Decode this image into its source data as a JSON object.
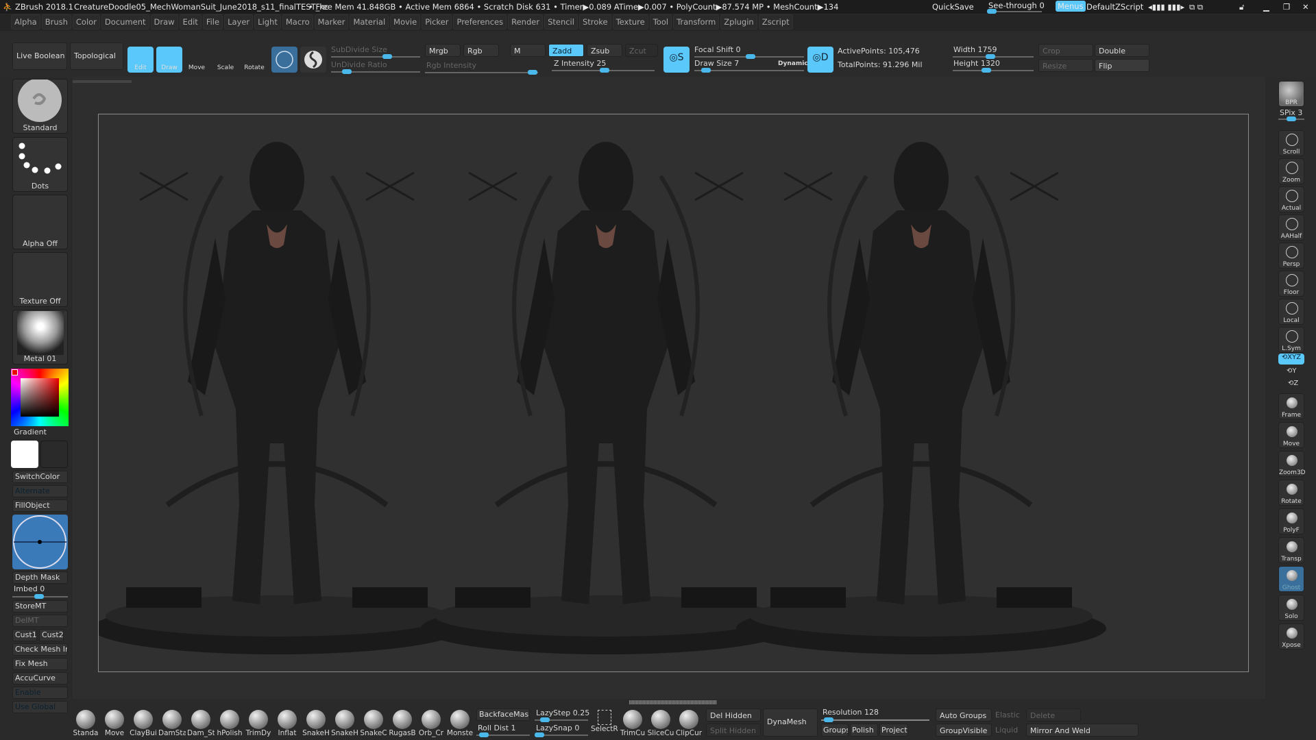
{
  "title": {
    "app": "ZBrush 2018.1",
    "file": "CreatureDoodle05_MechWomanSuit_June2018_s11_finalTEST_kc",
    "stats": "• Free Mem 41.848GB • Active Mem 6864 • Scratch Disk 631 • Timer▶0.089 ATime▶0.007 • PolyCount▶87.574 MP • MeshCount▶134",
    "quicksave": "QuickSave",
    "see_through": "See-through  0",
    "menus": "Menus",
    "script": "DefaultZScript"
  },
  "menus": [
    "Alpha",
    "Brush",
    "Color",
    "Document",
    "Draw",
    "Edit",
    "File",
    "Layer",
    "Light",
    "Macro",
    "Marker",
    "Material",
    "Movie",
    "Picker",
    "Preferences",
    "Render",
    "Stencil",
    "Stroke",
    "Texture",
    "Tool",
    "Transform",
    "Zplugin",
    "Zscript"
  ],
  "toolbar": {
    "live_boolean": "Live Boolean",
    "topological": "Topological",
    "edit": "Edit",
    "draw": "Draw",
    "move": "Move",
    "scale": "Scale",
    "rotate": "Rotate",
    "subdivide_size": "SubDivide Size",
    "undivide_ratio": "UnDivide Ratio",
    "mrgb": "Mrgb",
    "rgb": "Rgb",
    "rgb_intensity": "Rgb Intensity",
    "m": "M",
    "zadd": "Zadd",
    "zsub": "Zsub",
    "zcut": "Zcut",
    "z_intensity": "Z Intensity 25",
    "focal_shift": "Focal Shift 0",
    "draw_size": "Draw Size 7",
    "dynamic": "Dynamic",
    "active_points": "ActivePoints: 105,476",
    "total_points": "TotalPoints: 91.296 Mil",
    "width": "Width 1759",
    "height": "Height 1320",
    "crop": "Crop",
    "resize": "Resize",
    "double": "Double",
    "flip": "Flip",
    "accent": "#5ac8fa"
  },
  "left": {
    "brush": "Standard",
    "stroke": "Dots",
    "alpha": "Alpha Off",
    "texture": "Texture Off",
    "material": "Metal 01",
    "gradient": "Gradient",
    "switch_color": "SwitchColor",
    "alternate": "Alternate",
    "fill_object": "FillObject",
    "depth_mask": "Depth Mask",
    "imbed": "Imbed 0",
    "store_mt": "StoreMT",
    "del_mt": "DelMT",
    "cust1": "Cust1",
    "cust2": "Cust2",
    "check_mesh": "Check Mesh Int",
    "fix_mesh": "Fix Mesh",
    "accucurve": "AccuCurve",
    "enable": "Enable",
    "use_global": "Use Global"
  },
  "right": {
    "bpr": "BPR",
    "spix": "SPix 3",
    "buttons": [
      {
        "label": "Scroll",
        "icon": "hand-icon"
      },
      {
        "label": "Zoom",
        "icon": "magnifier-icon"
      },
      {
        "label": "Actual",
        "icon": "magnifier-icon"
      },
      {
        "label": "AAHalf",
        "icon": "magnifier-icon"
      },
      {
        "label": "Persp",
        "icon": "grid-icon",
        "on": true
      },
      {
        "label": "Floor",
        "icon": "floor-icon"
      },
      {
        "label": "Local",
        "icon": "local-icon",
        "on": true
      },
      {
        "label": "L.Sym",
        "icon": "symmetry-icon"
      }
    ],
    "xyz": "XYZ",
    "y": "Y",
    "z": "Z",
    "buttons2": [
      {
        "label": "Frame",
        "icon": "frame-icon"
      },
      {
        "label": "Move",
        "icon": "hand-icon"
      },
      {
        "label": "Zoom3D",
        "icon": "magnifier-icon"
      },
      {
        "label": "Rotate",
        "icon": "rotate-icon"
      },
      {
        "label": "PolyF",
        "icon": "polygrid-icon"
      },
      {
        "label": "Transp",
        "icon": "transparency-icon"
      },
      {
        "label": "Ghost",
        "icon": "ghost-icon",
        "ghost": true
      },
      {
        "label": "Solo",
        "icon": "solo-icon"
      },
      {
        "label": "Xpose",
        "icon": "xpose-icon"
      }
    ]
  },
  "bottom": {
    "brushes": [
      "Standa",
      "Move",
      "ClayBui",
      "DamSta",
      "Dam_St",
      "hPolish",
      "TrimDy",
      "Inflat",
      "SnakeH",
      "SnakeH",
      "SnakeC",
      "RugasB",
      "Orb_Cr",
      "Monste"
    ],
    "backface_mask": "BackfaceMask",
    "roll_dist": "Roll Dist 1",
    "lazy_step": "LazyStep 0.25",
    "lazy_snap": "LazySnap 0",
    "select_rect": "SelectRe",
    "trim_curve": "TrimCu",
    "slice_curve": "SliceCu",
    "clip_curve": "ClipCur",
    "del_hidden": "Del Hidden",
    "split_hidden": "Split Hidden",
    "dynamesh": "DynaMesh",
    "resolution": "Resolution 128",
    "groups": "Groups",
    "polish": "Polish",
    "project": "Project",
    "auto_groups": "Auto Groups",
    "group_visible": "GroupVisible",
    "elastic": "Elastic",
    "liquid": "Liquid",
    "delete": "Delete",
    "mirror_weld": "Mirror And Weld"
  }
}
